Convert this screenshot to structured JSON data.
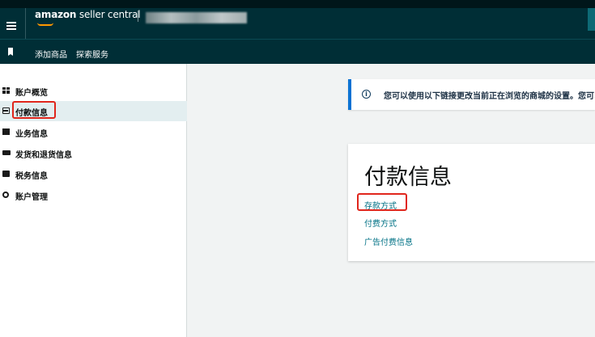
{
  "header": {
    "brand_amazon": "amazon",
    "brand_rest": " seller central",
    "brand_accent_color": "#ff9900",
    "bar_color": "#002e36"
  },
  "subnav": {
    "items": [
      "添加商品",
      "探索服务"
    ]
  },
  "sidebar": {
    "items": [
      {
        "label": "账户概览",
        "icon": "dashboard-icon"
      },
      {
        "label": "付款信息",
        "icon": "credit-card-icon",
        "active": true
      },
      {
        "label": "业务信息",
        "icon": "building-icon"
      },
      {
        "label": "发货和退货信息",
        "icon": "truck-icon"
      },
      {
        "label": "税务信息",
        "icon": "briefcase-icon"
      },
      {
        "label": "账户管理",
        "icon": "gear-icon"
      }
    ]
  },
  "banner": {
    "text": "您可以使用以下链接更改当前正在浏览的商城的设置。您可以"
  },
  "card": {
    "title": "付款信息",
    "links": [
      "存款方式",
      "付费方式",
      "广告付费信息"
    ]
  },
  "highlight_color": "#e0261c",
  "link_color": "#007185"
}
